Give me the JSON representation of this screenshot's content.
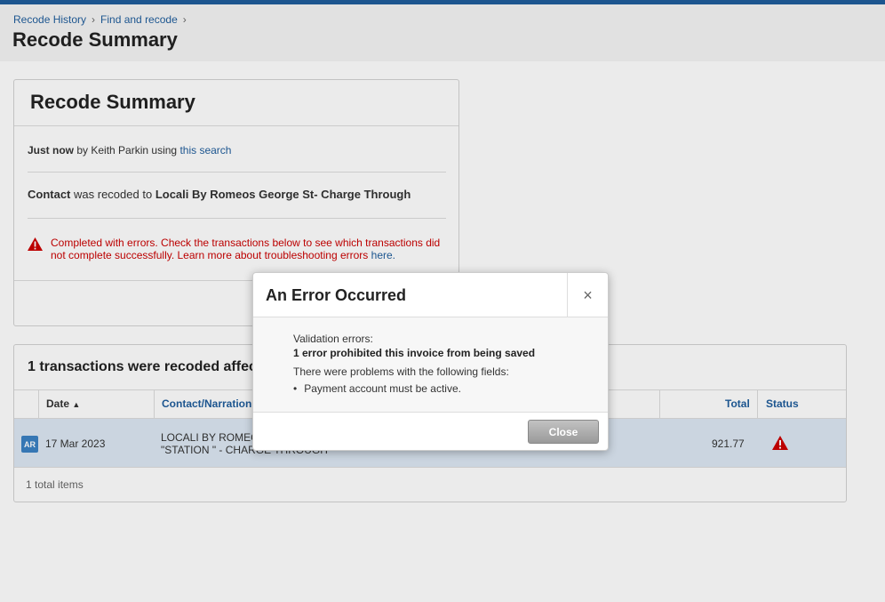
{
  "breadcrumb": {
    "items": [
      "Recode History",
      "Find and recode"
    ],
    "sep": "›"
  },
  "page_title": "Recode Summary",
  "summary": {
    "title": "Recode Summary",
    "line1": {
      "when": "Just now",
      "by_text": "by Keith Parkin using",
      "link": "this search"
    },
    "line2": {
      "label": "Contact",
      "mid": "was recoded to",
      "target": "Locali By Romeos George St- Charge Through"
    },
    "error_text": "Completed with errors. Check the transactions below to see which transactions did not complete successfully. Learn more about troubleshooting errors",
    "error_link": "here."
  },
  "table": {
    "title": "1 transactions were recoded affec",
    "columns": {
      "date": "Date",
      "sort_arrow": "▲",
      "contact": "Contact/Narration",
      "total": "Total",
      "status": "Status"
    },
    "rows": [
      {
        "badge": "AR",
        "date": "17 Mar 2023",
        "contact_line1": "LOCALI BY ROMEO",
        "contact_line2": "\"STATION \" - CHARGE THROUGH",
        "total": "921.77"
      }
    ],
    "footer": "1 total items"
  },
  "modal": {
    "title": "An Error Occurred",
    "close_x": "×",
    "validation_label": "Validation errors:",
    "error_summary": "1 error prohibited this invoice from being saved",
    "problems_label": "There were problems with the following fields:",
    "problems": [
      "Payment account must be active."
    ],
    "close_button": "Close"
  },
  "colors": {
    "accent": "#1f5d9c",
    "error": "#cc0000",
    "row_highlight": "#dde8f3"
  }
}
